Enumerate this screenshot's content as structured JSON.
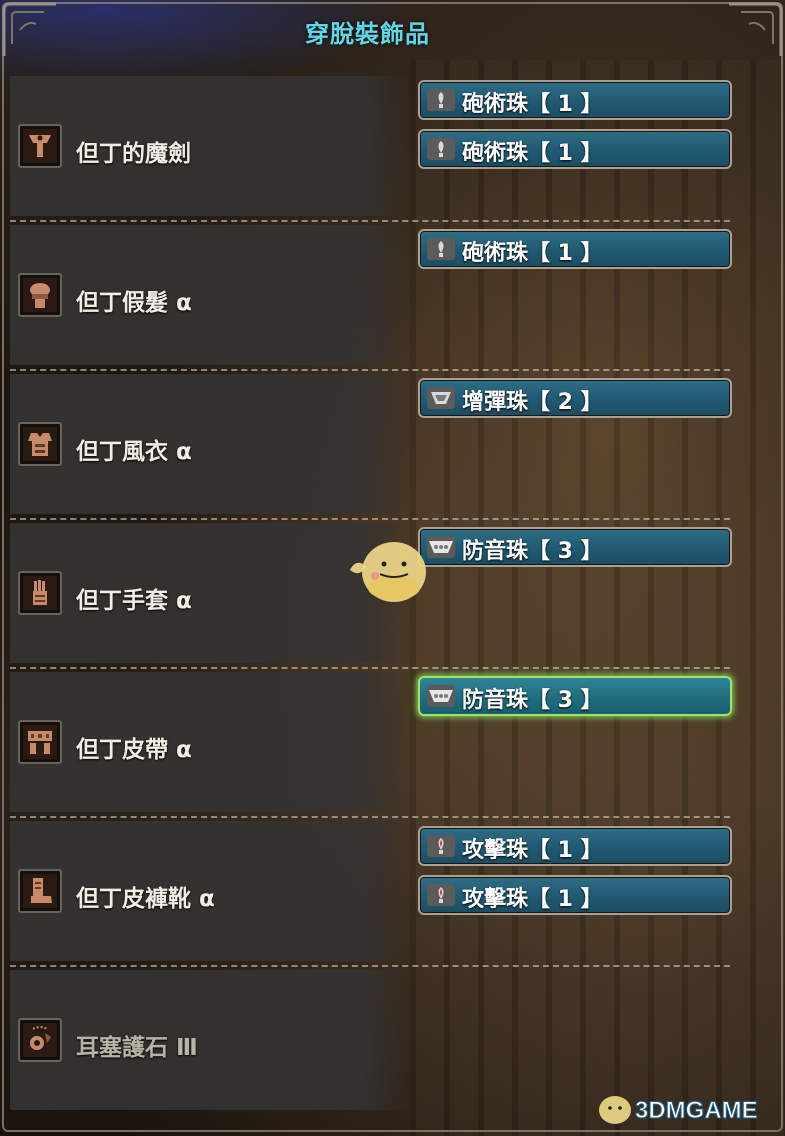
{
  "screen": {
    "title": "穿脫裝飾品"
  },
  "equipment": [
    {
      "name": "但丁的魔劍",
      "icon": "weapon-icon",
      "dim": false,
      "decorations": [
        {
          "label": "砲術珠【 1 】",
          "icon": "jewel-slot-1-icon"
        },
        {
          "label": "砲術珠【 1 】",
          "icon": "jewel-slot-1-icon"
        }
      ]
    },
    {
      "name": "但丁假髮 α",
      "icon": "helmet-icon",
      "dim": false,
      "decorations": [
        {
          "label": "砲術珠【 1 】",
          "icon": "jewel-slot-1-icon"
        }
      ]
    },
    {
      "name": "但丁風衣 α",
      "icon": "chest-armor-icon",
      "dim": false,
      "decorations": [
        {
          "label": "增彈珠【 2 】",
          "icon": "jewel-slot-2-icon"
        }
      ]
    },
    {
      "name": "但丁手套 α",
      "icon": "gloves-icon",
      "dim": false,
      "decorations": [
        {
          "label": "防音珠【 3 】",
          "icon": "jewel-slot-3-icon"
        }
      ]
    },
    {
      "name": "但丁皮帶 α",
      "icon": "belt-icon",
      "dim": false,
      "decorations": [
        {
          "label": "防音珠【 3 】",
          "icon": "jewel-slot-3-icon",
          "selected": true
        }
      ]
    },
    {
      "name": "但丁皮褲靴 α",
      "icon": "boots-icon",
      "dim": false,
      "decorations": [
        {
          "label": "攻擊珠【 1 】",
          "icon": "jewel-slot-1-red-icon"
        },
        {
          "label": "攻擊珠【 1 】",
          "icon": "jewel-slot-1-red-icon"
        }
      ]
    },
    {
      "name": "耳塞護石 Ⅲ",
      "icon": "charm-icon",
      "dim": true,
      "decorations": []
    }
  ],
  "watermark": {
    "text": "3DMGAME"
  },
  "colors": {
    "title": "#5fd7e9",
    "deco_bg": "#1f5870",
    "selected_glow": "#9fe36a"
  }
}
